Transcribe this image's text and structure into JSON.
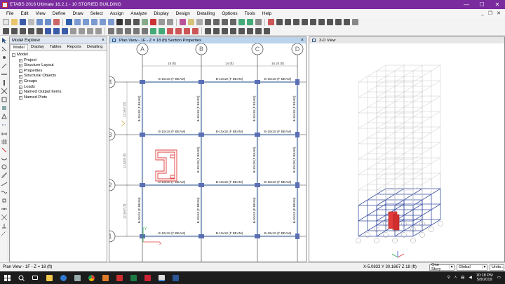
{
  "window": {
    "title": "ETABS 2016 Ultimate 16.2.1 - 10 STORIED BUILDING",
    "minimize": "—",
    "maximize": "☐",
    "close": "✕"
  },
  "menu": [
    "File",
    "Edit",
    "View",
    "Define",
    "Draw",
    "Select",
    "Assign",
    "Analyze",
    "Display",
    "Design",
    "Detailing",
    "Options",
    "Tools",
    "Help"
  ],
  "mdi_controls": {
    "min": "_",
    "restore": "❐",
    "close": "✕"
  },
  "explorer": {
    "title": "Model Explorer",
    "tabs": [
      "Model",
      "Display",
      "Tables",
      "Reports",
      "Detailing"
    ],
    "root": "Model",
    "children": [
      "Project",
      "Structure Layout",
      "Properties",
      "Structural Objects",
      "Groups",
      "Loads",
      "Named Output Items",
      "Named Plots"
    ]
  },
  "plan_view": {
    "title": "Plan View - 1F - Z = 18 (ft)  Section Properties",
    "grid_x": [
      "A",
      "B",
      "C",
      "D"
    ],
    "grid_y": [
      "4",
      "3",
      "2",
      "1"
    ],
    "dims_top": [
      "18 (ft)",
      "14 (ft)",
      "16.25 (ft)"
    ],
    "dims_left": [
      "12.1667 (ft)",
      "12.8333 (ft)",
      "12.4667 (ft)"
    ],
    "beam_label": "B-10x18 (F BEAM)",
    "axis_x": "X",
    "axis_y": "Y"
  },
  "view_3d": {
    "title": "3-D View"
  },
  "statusbar": {
    "left": "Plan View - 1F - Z = 18 (ft)",
    "coords": "X-5.0833  Y 30.1667  Z 18 (ft)",
    "story_dropdown": "One Story",
    "global_dropdown": "Global",
    "units_dropdown": "Units..."
  },
  "taskbar": {
    "time": "10:18 PM",
    "date": "5/9/2019"
  },
  "colors": {
    "titlebar": "#7a2b9e",
    "beam": "#8fa6c4",
    "column": "#5a6fb5",
    "gridline": "#333333",
    "selection": "#e23b3b",
    "frame3d": "#c8c8c8",
    "frame3d_lower": "#3a4fa0"
  }
}
